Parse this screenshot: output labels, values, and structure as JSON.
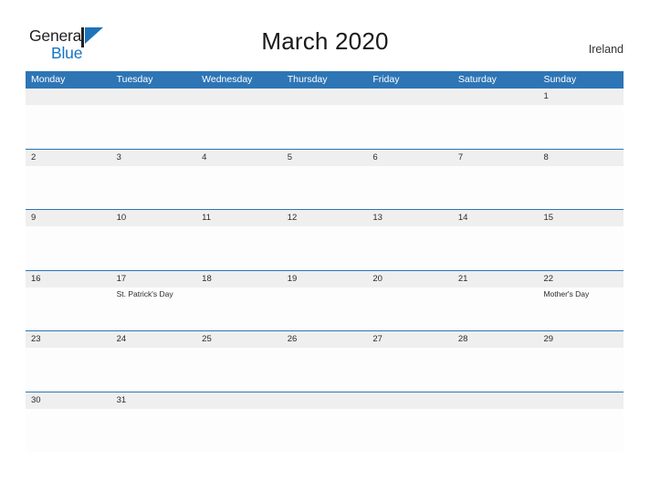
{
  "brand": {
    "word_one": "General",
    "word_two": "Blue",
    "flag_icon": "blue-flag-triangle-icon",
    "color_dark": "#231f20",
    "color_blue": "#1573c4"
  },
  "header": {
    "title": "March 2020",
    "country": "Ireland",
    "accent_color": "#2e75b6",
    "band_color": "#efefef"
  },
  "calendar": {
    "weekday_headers": [
      "Monday",
      "Tuesday",
      "Wednesday",
      "Thursday",
      "Friday",
      "Saturday",
      "Sunday"
    ],
    "weeks": [
      {
        "days": [
          {
            "num": "",
            "event": ""
          },
          {
            "num": "",
            "event": ""
          },
          {
            "num": "",
            "event": ""
          },
          {
            "num": "",
            "event": ""
          },
          {
            "num": "",
            "event": ""
          },
          {
            "num": "",
            "event": ""
          },
          {
            "num": "1",
            "event": ""
          }
        ]
      },
      {
        "days": [
          {
            "num": "2",
            "event": ""
          },
          {
            "num": "3",
            "event": ""
          },
          {
            "num": "4",
            "event": ""
          },
          {
            "num": "5",
            "event": ""
          },
          {
            "num": "6",
            "event": ""
          },
          {
            "num": "7",
            "event": ""
          },
          {
            "num": "8",
            "event": ""
          }
        ]
      },
      {
        "days": [
          {
            "num": "9",
            "event": ""
          },
          {
            "num": "10",
            "event": ""
          },
          {
            "num": "11",
            "event": ""
          },
          {
            "num": "12",
            "event": ""
          },
          {
            "num": "13",
            "event": ""
          },
          {
            "num": "14",
            "event": ""
          },
          {
            "num": "15",
            "event": ""
          }
        ]
      },
      {
        "days": [
          {
            "num": "16",
            "event": ""
          },
          {
            "num": "17",
            "event": "St. Patrick's Day"
          },
          {
            "num": "18",
            "event": ""
          },
          {
            "num": "19",
            "event": ""
          },
          {
            "num": "20",
            "event": ""
          },
          {
            "num": "21",
            "event": ""
          },
          {
            "num": "22",
            "event": "Mother's Day"
          }
        ]
      },
      {
        "days": [
          {
            "num": "23",
            "event": ""
          },
          {
            "num": "24",
            "event": ""
          },
          {
            "num": "25",
            "event": ""
          },
          {
            "num": "26",
            "event": ""
          },
          {
            "num": "27",
            "event": ""
          },
          {
            "num": "28",
            "event": ""
          },
          {
            "num": "29",
            "event": ""
          }
        ]
      },
      {
        "days": [
          {
            "num": "30",
            "event": ""
          },
          {
            "num": "31",
            "event": ""
          },
          {
            "num": "",
            "event": ""
          },
          {
            "num": "",
            "event": ""
          },
          {
            "num": "",
            "event": ""
          },
          {
            "num": "",
            "event": ""
          },
          {
            "num": "",
            "event": ""
          }
        ]
      }
    ]
  }
}
